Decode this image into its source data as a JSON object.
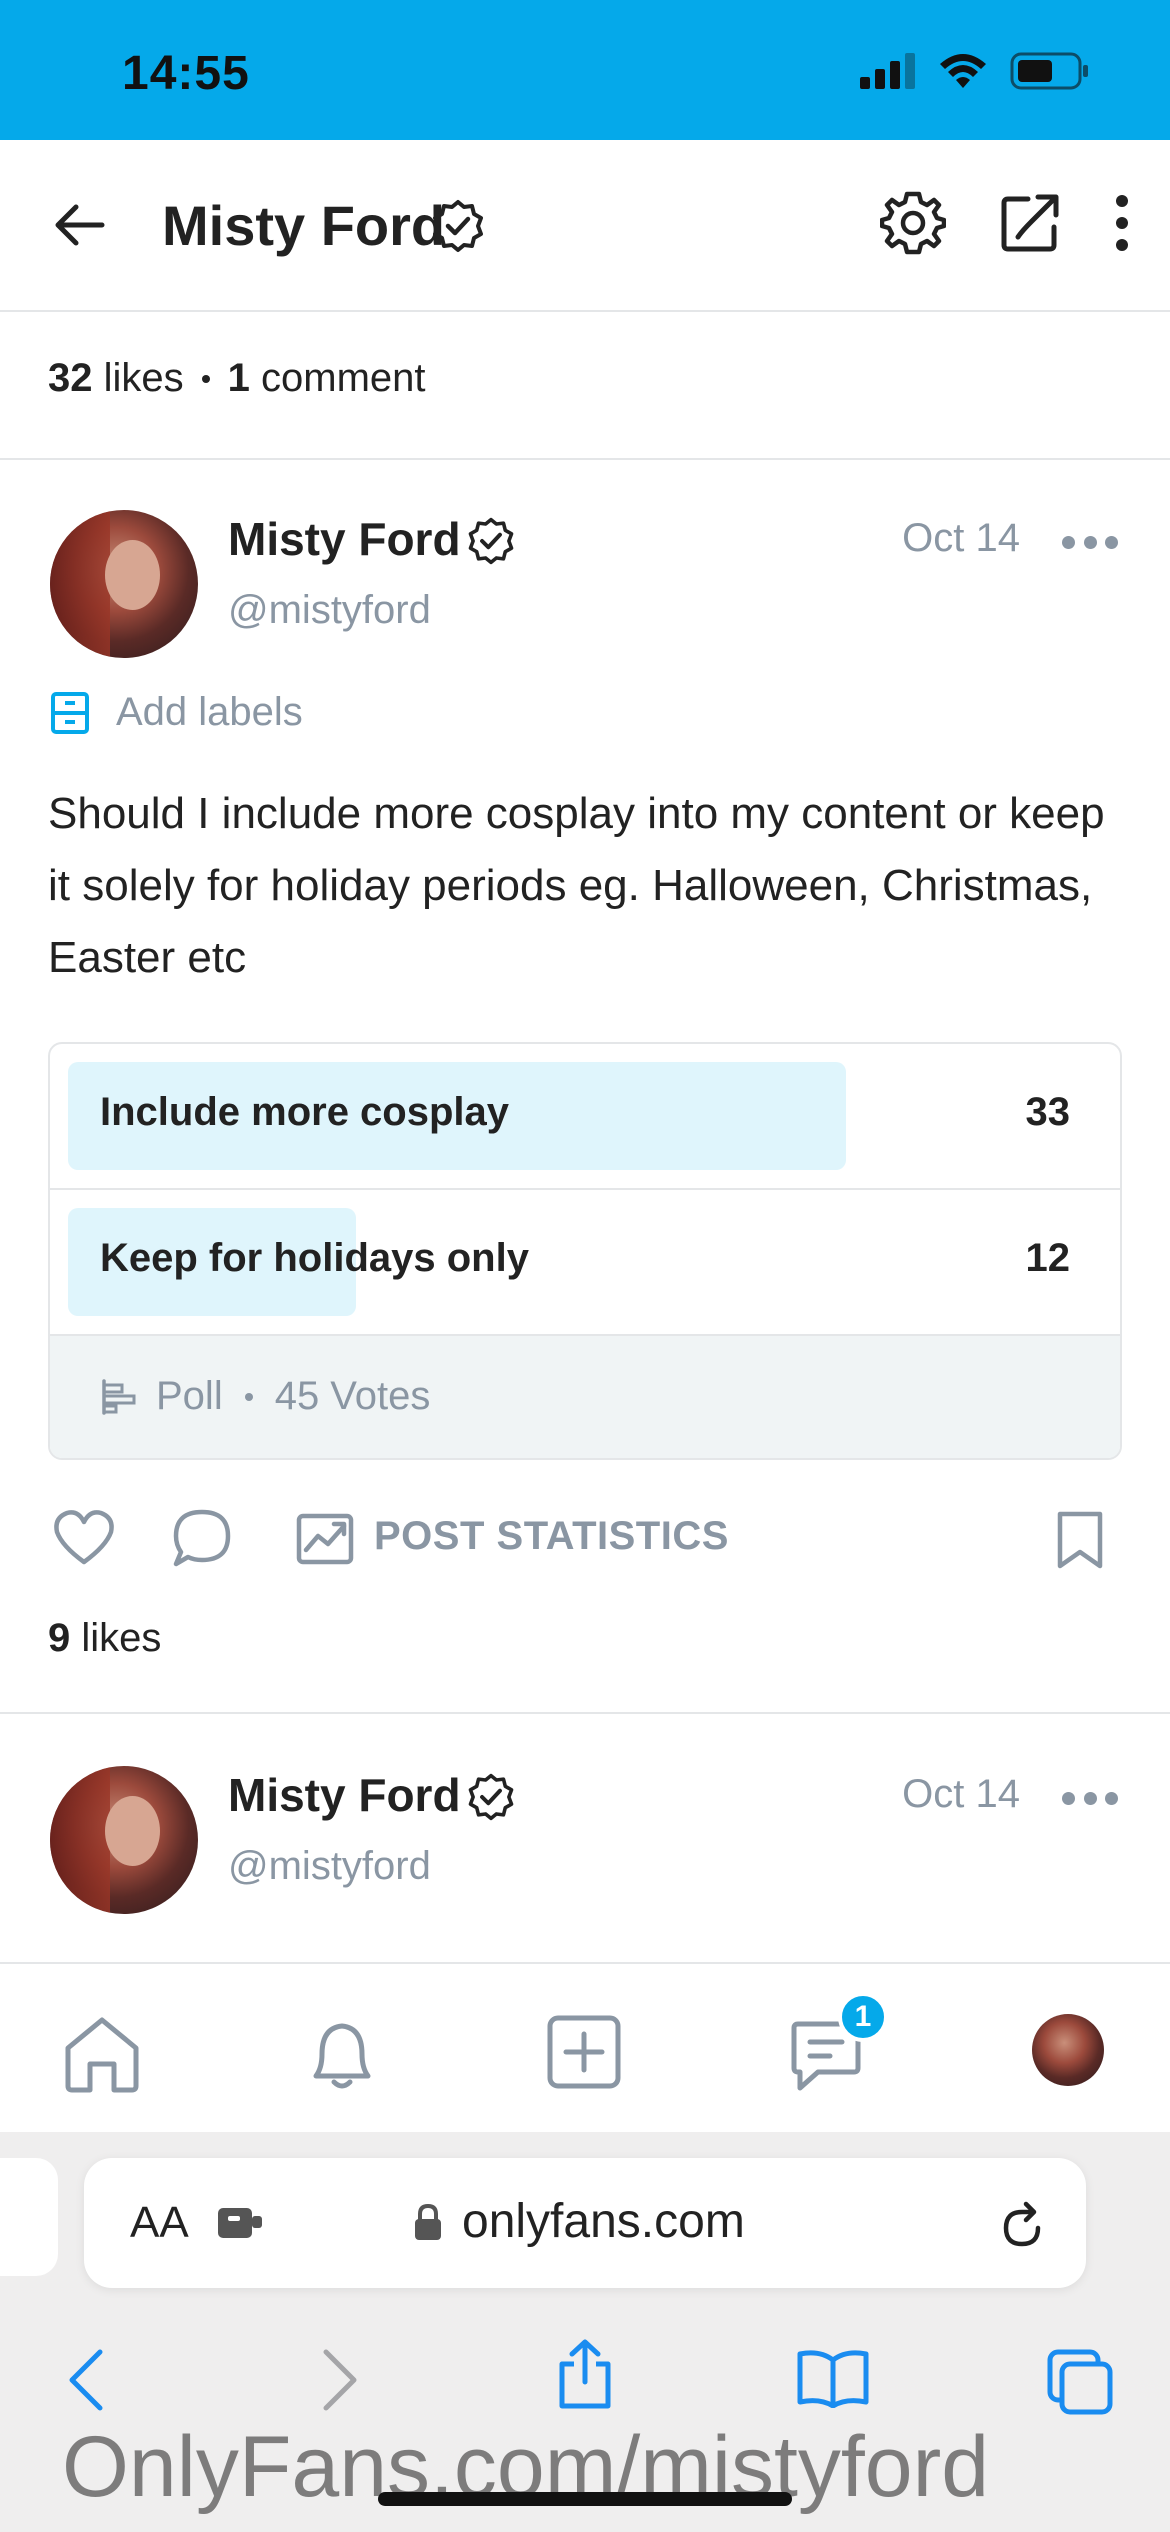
{
  "status_bar": {
    "time": "14:55"
  },
  "header": {
    "title": "Misty Ford"
  },
  "summary": {
    "likes": "32",
    "likes_label": "likes",
    "comments": "1",
    "comments_label": "comment"
  },
  "post1": {
    "author": "Misty Ford",
    "handle": "@mistyford",
    "date": "Oct 14",
    "labels_label": "Add labels",
    "text": "Should I include more cosplay into my content or keep it solely for holiday periods eg. Halloween, Christmas, Easter etc",
    "poll": {
      "options": [
        {
          "label": "Include more cosplay",
          "votes": "33",
          "fraction": 0.73
        },
        {
          "label": "Keep for holidays only",
          "votes": "12",
          "fraction": 0.27
        }
      ],
      "type_label": "Poll",
      "total_label": "45 Votes"
    },
    "stats_label": "POST STATISTICS",
    "likes": "9",
    "likes_label": "likes"
  },
  "post2": {
    "author": "Misty Ford",
    "handle": "@mistyford",
    "date": "Oct 14"
  },
  "bottom_nav": {
    "messages_badge": "1"
  },
  "browser": {
    "aa_label": "AA",
    "url": "onlyfans.com"
  },
  "watermark": "OnlyFans.com/mistyford",
  "colors": {
    "accent": "#05a9ea",
    "muted": "#8a96a3",
    "poll_fill": "#dff5fc"
  }
}
